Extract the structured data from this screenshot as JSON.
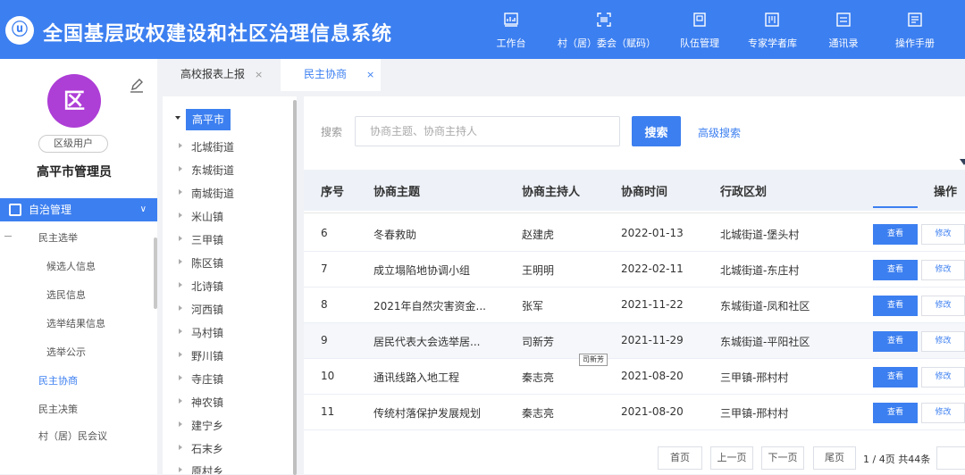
{
  "app": {
    "logo_text": "ⓤ",
    "title": "全国基层政权建设和社区治理信息系统"
  },
  "nav": [
    {
      "label": "工作台",
      "icon": "chart-icon"
    },
    {
      "label": "村（居）委会（赋码）",
      "icon": "scan-icon"
    },
    {
      "label": "队伍管理",
      "icon": "team-icon"
    },
    {
      "label": "专家学者库",
      "icon": "library-icon"
    },
    {
      "label": "通讯录",
      "icon": "contacts-icon"
    },
    {
      "label": "操作手册",
      "icon": "manual-icon"
    }
  ],
  "user": {
    "avatar_text": "区",
    "role": "区级用户",
    "name": "高平市管理员"
  },
  "sidebar": {
    "section": "自治管理",
    "items": [
      "民主选举",
      "候选人信息",
      "选民信息",
      "选举结果信息",
      "选举公示",
      "民主协商",
      "民主决策",
      "村（居）民会议"
    ]
  },
  "tabs": [
    {
      "label": "高校报表上报",
      "close": "×"
    },
    {
      "label": "民主协商",
      "close": "×"
    }
  ],
  "tree": {
    "root": "高平市",
    "nodes": [
      "北城街道",
      "东城街道",
      "南城街道",
      "米山镇",
      "三甲镇",
      "陈区镇",
      "北诗镇",
      "河西镇",
      "马村镇",
      "野川镇",
      "寺庄镇",
      "神农镇",
      "建宁乡",
      "石末乡",
      "原村乡"
    ]
  },
  "search": {
    "label": "搜索",
    "placeholder": "协商主题、协商主持人",
    "button": "搜索",
    "advanced": "高级搜索"
  },
  "table": {
    "headers": [
      "序号",
      "协商主题",
      "协商主持人",
      "协商时间",
      "行政区划",
      "操作"
    ],
    "view_label": "查看",
    "edit_label": "修改",
    "rows": [
      {
        "no": "6",
        "topic": "冬春救助",
        "host": "赵建虎",
        "date": "2022-01-13",
        "region": "北城街道-堡头村"
      },
      {
        "no": "7",
        "topic": "成立塌陷地协调小组",
        "host": "王明明",
        "date": "2022-02-11",
        "region": "北城街道-东庄村"
      },
      {
        "no": "8",
        "topic": "2021年自然灾害资金...",
        "host": "张军",
        "date": "2021-11-22",
        "region": "东城街道-凤和社区"
      },
      {
        "no": "9",
        "topic": "居民代表大会选举居...",
        "host": "司新芳",
        "date": "2021-11-29",
        "region": "东城街道-平阳社区"
      },
      {
        "no": "10",
        "topic": "通讯线路入地工程",
        "host": "秦志亮",
        "date": "2021-08-20",
        "region": "三甲镇-邢村村"
      },
      {
        "no": "11",
        "topic": "传统村落保护发展规划",
        "host": "秦志亮",
        "date": "2021-08-20",
        "region": "三甲镇-邢村村"
      }
    ],
    "tooltip": "司新芳"
  },
  "pager": {
    "first": "首页",
    "prev": "上一页",
    "next": "下一页",
    "last": "尾页",
    "info": "1 / 4页 共44条"
  },
  "colors": {
    "primary": "#3c7ff0",
    "avatar": "#ad3ed6"
  }
}
